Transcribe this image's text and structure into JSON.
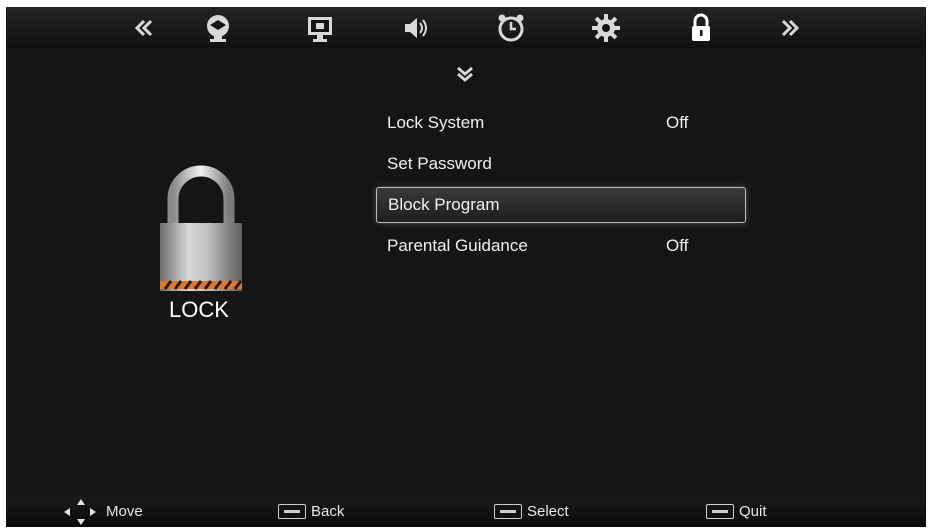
{
  "topbar": {
    "icons": [
      "chevron-left-double-icon",
      "picture-icon",
      "display-icon",
      "sound-icon",
      "clock-icon",
      "gear-icon",
      "lock-icon",
      "chevron-right-double-icon"
    ],
    "active_color": "#ffffff"
  },
  "menu": {
    "items": [
      {
        "label": "Lock System",
        "value": "Off"
      },
      {
        "label": "Set Password",
        "value": ""
      },
      {
        "label": "Block Program",
        "value": ""
      },
      {
        "label": "Parental Guidance",
        "value": "Off"
      }
    ],
    "selected_index": 2
  },
  "section": {
    "title": "LOCK",
    "icon": "padlock-icon"
  },
  "footer": {
    "move": "Move",
    "back": "Back",
    "select": "Select",
    "quit": "Quit"
  },
  "colors": {
    "background": "#151515",
    "text": "#f0f0f0",
    "stripe_orange": "#e8761a"
  }
}
